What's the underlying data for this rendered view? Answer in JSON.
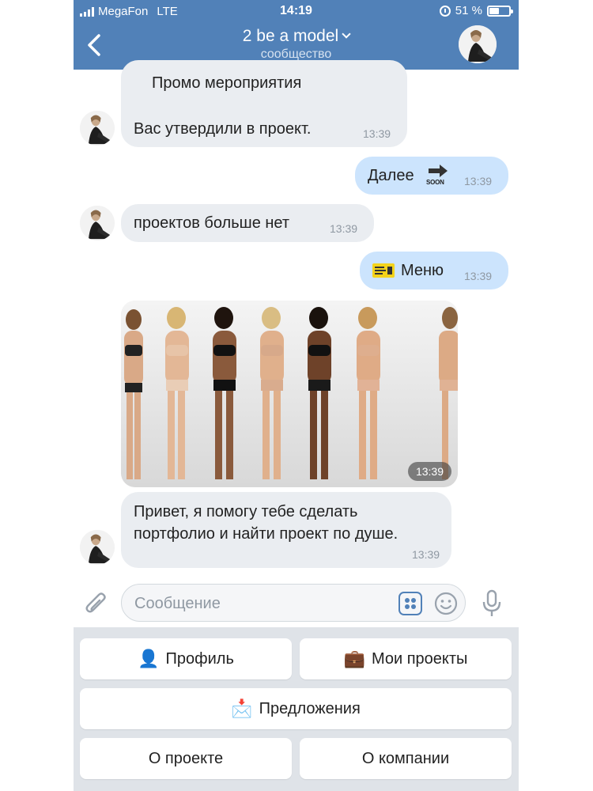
{
  "status_bar": {
    "carrier": "MegaFon",
    "network": "LTE",
    "time": "14:19",
    "battery_level": "51 %",
    "battery_fraction": 0.51
  },
  "header": {
    "title": "2 be a model",
    "subtitle": "сообщество"
  },
  "messages": [
    {
      "direction": "in",
      "lines": [
        "Промо мероприятия",
        "Вас утвердили в проект."
      ],
      "time": "13:39"
    },
    {
      "direction": "out",
      "text": "Далее",
      "icon": "soon-arrow-icon",
      "time": "13:39"
    },
    {
      "direction": "in",
      "text": "проектов больше нет",
      "time": "13:39"
    },
    {
      "direction": "out",
      "text": "Меню",
      "icon": "ticket-icon",
      "time": "13:39"
    },
    {
      "direction": "in",
      "type": "photo",
      "time": "13:39"
    },
    {
      "direction": "in",
      "lines": [
        "Привет, я помогу тебе сделать",
        "портфолио и найти проект по душе."
      ],
      "time": "13:39"
    }
  ],
  "soon_label": "SOON",
  "input": {
    "placeholder": "Сообщение"
  },
  "keyboard": [
    {
      "label": "Профиль",
      "icon": "bust-icon"
    },
    {
      "label": "Мои проекты",
      "icon": "briefcase-icon"
    },
    {
      "label": "Предложения",
      "icon": "envelope-icon"
    },
    {
      "label": "О проекте"
    },
    {
      "label": "О компании"
    }
  ],
  "colors": {
    "header": "#5181b8",
    "incoming_bubble": "#eaedf1",
    "outgoing_bubble": "#cce4fd",
    "keyboard_bg": "#dfe3e8"
  }
}
